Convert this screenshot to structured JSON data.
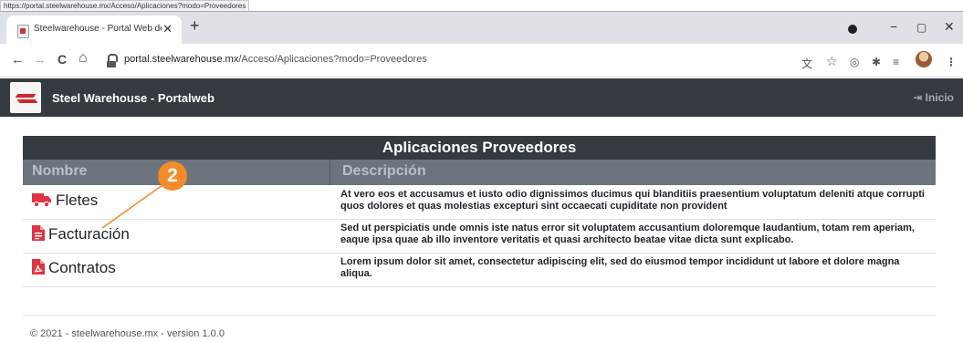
{
  "hover_url": "https://portal.steelwarehouse.mx/Acceso/Aplicaciones?modo=Proveedores",
  "browser": {
    "tab_title": "Steelwarehouse - Portal Web de",
    "new_tab": "+",
    "close_tab": "✕",
    "url_host": "portal.steelwarehouse.mx",
    "url_path": "/Acceso/Aplicaciones?modo=Proveedores",
    "back": "←",
    "forward": "→",
    "reload": "C",
    "home": "⌂",
    "minimize": "−",
    "maximize": "▢",
    "close_window": "✕"
  },
  "navbar": {
    "brand": "Steel Warehouse - Portalweb",
    "inicio": "Inicio"
  },
  "table": {
    "caption": "Aplicaciones Proveedores",
    "col_name": "Nombre",
    "col_desc": "Descripción",
    "rows": [
      {
        "name": "Fletes",
        "icon": "truck-icon",
        "desc": "At vero eos et accusamus et iusto odio dignissimos ducimus qui blanditiis praesentium voluptatum deleniti atque corrupti quos dolores et quas molestias excepturi sint occaecati cupiditate non provident"
      },
      {
        "name": "Facturación",
        "icon": "invoice-icon",
        "desc": "Sed ut perspiciatis unde omnis iste natus error sit voluptatem accusantium doloremque laudantium, totam rem aperiam, eaque ipsa quae ab illo inventore veritatis et quasi architecto beatae vitae dicta sunt explicabo."
      },
      {
        "name": "Contratos",
        "icon": "pdf-file-icon",
        "desc": "Lorem ipsum dolor sit amet, consectetur adipiscing elit, sed do eiusmod tempor incididunt ut labore et dolore magna aliqua."
      }
    ]
  },
  "footer": "© 2021 - steelwarehouse.mx - version 1.0.0",
  "annotation": {
    "number": "2",
    "color": "#f28c28"
  },
  "colors": {
    "navbar": "#343a40",
    "table_header": "#6c757d",
    "icon_red": "#dc3545"
  }
}
